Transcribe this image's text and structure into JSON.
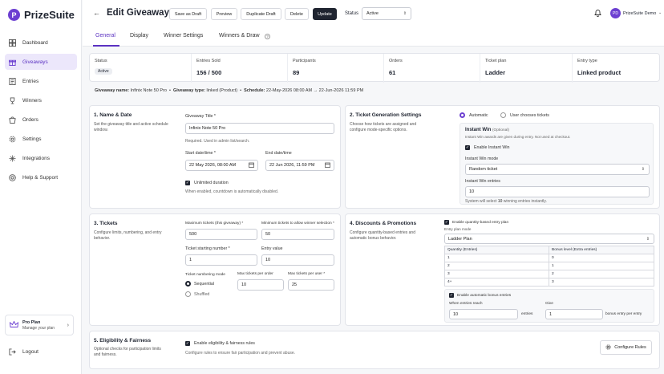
{
  "app": {
    "name": "PrizeSuite",
    "logo_letter": "P"
  },
  "sidebar": {
    "items": [
      {
        "label": "Dashboard",
        "icon": "dashboard-icon"
      },
      {
        "label": "Giveaways",
        "icon": "gift-icon",
        "active": true
      },
      {
        "label": "Entries",
        "icon": "entries-icon"
      },
      {
        "label": "Winners",
        "icon": "trophy-icon"
      },
      {
        "label": "Orders",
        "icon": "orders-icon"
      },
      {
        "label": "Settings",
        "icon": "gear-icon"
      },
      {
        "label": "Integrations",
        "icon": "integrations-icon"
      },
      {
        "label": "Help & Support",
        "icon": "help-icon"
      }
    ],
    "plan": {
      "title": "Pro Plan",
      "subtitle": "Manage your plan"
    },
    "logout": "Logout"
  },
  "header": {
    "title": "Edit Giveaway",
    "buttons": {
      "save_draft": "Save as Draft",
      "preview": "Preview",
      "duplicate": "Duplicate Draft",
      "delete": "Delete",
      "update": "Update"
    },
    "status_label": "Status",
    "status_value": "Active",
    "user_initials": "PD",
    "user_name": "PrizeSuite Demo"
  },
  "tabs": [
    {
      "label": "General",
      "active": true
    },
    {
      "label": "Display"
    },
    {
      "label": "Winner Settings"
    },
    {
      "label": "Winners & Draw",
      "help": "?"
    }
  ],
  "stats": {
    "status": {
      "label": "Status",
      "value": "Active"
    },
    "entries": {
      "label": "Entries Sold",
      "value": "156 / 500"
    },
    "participants": {
      "label": "Participants",
      "value": "89"
    },
    "orders": {
      "label": "Orders",
      "value": "61"
    },
    "ticket_plan": {
      "label": "Ticket plan",
      "value": "Ladder"
    },
    "entry_type": {
      "label": "Entry type",
      "value": "Linked product"
    }
  },
  "info": {
    "name_label": "Giveaway name:",
    "name_value": "Infinix Note 50 Pro",
    "type_label": "Giveaway type:",
    "type_value": "linked (Product)",
    "schedule_label": "Schedule:",
    "schedule_value": "22-May-2026 08:00 AM → 22-Jun-2026 11:59 PM"
  },
  "name_date": {
    "title": "1. Name & Date",
    "desc": "Set the giveaway title and active schedule window.",
    "title_label": "Giveaway Title *",
    "title_value": "Infinix Note 50 Pro",
    "title_hint": "Required. Used in admin list/search.",
    "start_label": "Start date/time *",
    "start_value": "22 May 2026, 08:00 AM",
    "end_label": "End date/time",
    "end_value": "22 Jun 2026, 11:59 PM",
    "unlimited_label": "Unlimited duration",
    "unlimited_hint": "When enabled, countdown is automatically disabled."
  },
  "ticket_gen": {
    "title": "2. Ticket Generation Settings",
    "desc": "Choose how tickets are assigned and configure mode-specific options.",
    "mode_auto": "Automatic",
    "mode_user": "User chooses tickets",
    "instant_title": "Instant Win",
    "instant_optional": "(Optional)",
    "instant_desc": "Instant Win awards are given during entry. Not used at checkout.",
    "enable_label": "Enable Instant Win",
    "mode_label": "Instant Win mode",
    "mode_value": "Random ticket",
    "entries_label": "Instant Win entries",
    "entries_value": "10",
    "note_prefix": "System will select",
    "note_count": "10",
    "note_suffix": "winning entries instantly."
  },
  "tickets": {
    "title": "3. Tickets",
    "desc": "Configure limits, numbering, and entry behavior.",
    "max_label": "Maximum tickets (this giveaway) *",
    "max_value": "500",
    "min_label": "Minimum tickets to allow winner selection *",
    "min_value": "50",
    "start_label": "Ticket starting number *",
    "start_value": "1",
    "entry_label": "Entry value",
    "entry_value": "10",
    "numbering_label": "Ticket numbering mode",
    "seq": "Sequential",
    "shuf": "Shuffled",
    "per_order_label": "Max tickets per order",
    "per_order_value": "10",
    "per_user_label": "Max tickets per user *",
    "per_user_value": "25"
  },
  "discounts": {
    "title": "4. Discounts & Promotions",
    "desc": "Configure quantity-based entries and automatic bonus behavior.",
    "enable_label": "Enable quantity-based entry plan",
    "plan_mode_label": "Entry plan mode",
    "plan_mode_value": "Ladder Plan",
    "col_qty": "Quantity (Entries)",
    "col_bonus": "Bonus level (Extra entries)",
    "rows": [
      {
        "qty": "1",
        "bonus": "0"
      },
      {
        "qty": "2",
        "bonus": "1"
      },
      {
        "qty": "3",
        "bonus": "2"
      },
      {
        "qty": "4+",
        "bonus": "3"
      }
    ],
    "auto_label": "Enable automatic bonus entries",
    "reach_label": "When entries reach",
    "reach_value": "10",
    "entries_unit": "entries",
    "give_label": "Give",
    "give_value": "1",
    "bonus_unit": "bonus entry per entry"
  },
  "eligibility": {
    "title": "5. Eligibility & Fairness",
    "desc": "Optional checks for participation limits and fairness.",
    "enable_label": "Enable eligibility & fairness rules",
    "hint": "Configure rules to ensure fair participation and prevent abuse.",
    "button": "Configure Rules"
  }
}
